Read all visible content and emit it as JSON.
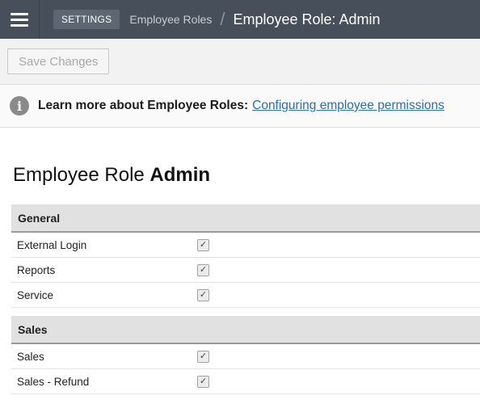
{
  "header": {
    "settings_label": "SETTINGS",
    "breadcrumb": "Employee Roles",
    "separator": "/",
    "title": "Employee Role: Admin"
  },
  "toolbar": {
    "save_label": "Save Changes"
  },
  "info": {
    "text": "Learn more about Employee Roles:",
    "link": "Configuring employee permissions",
    "icon": "info-icon"
  },
  "page": {
    "heading_prefix": "Employee Role",
    "heading_role": "Admin"
  },
  "sections": [
    {
      "title": "General",
      "rows": [
        {
          "label": "External Login",
          "checked": true
        },
        {
          "label": "Reports",
          "checked": true
        },
        {
          "label": "Service",
          "checked": true
        }
      ]
    },
    {
      "title": "Sales",
      "rows": [
        {
          "label": "Sales",
          "checked": true
        },
        {
          "label": "Sales - Refund",
          "checked": true
        }
      ]
    }
  ]
}
